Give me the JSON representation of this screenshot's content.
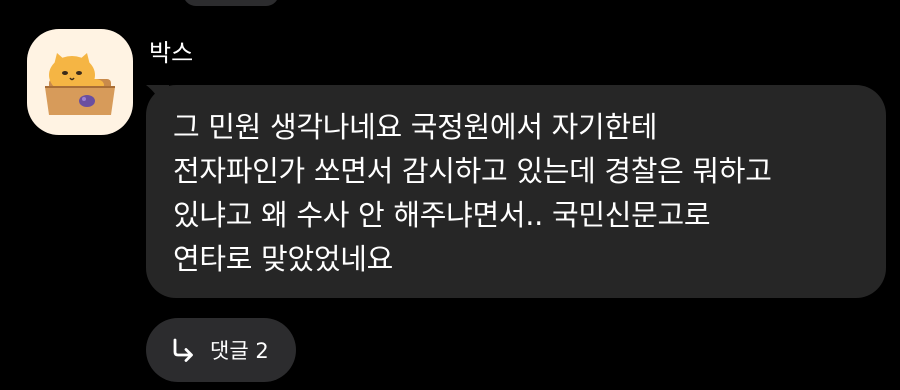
{
  "comment": {
    "author": "박스",
    "message_lines": [
      "그 민원 생각나네요 국정원에서 자기한테",
      "전자파인가 쏘면서 감시하고 있는데 경찰은 뭐하고",
      "있냐고 왜 수사 안 해주냐면서.. 국민신문고로",
      "연타로 맞았었네요"
    ],
    "reply_button": {
      "label": "댓글 2",
      "icon": "reply-arrow-icon"
    },
    "avatar_icon": "cat-in-box-icon"
  },
  "colors": {
    "background": "#000000",
    "bubble": "#262626",
    "pill": "#2c2c2e",
    "avatar_bg": "#fff3e3",
    "text": "#ffffff"
  }
}
